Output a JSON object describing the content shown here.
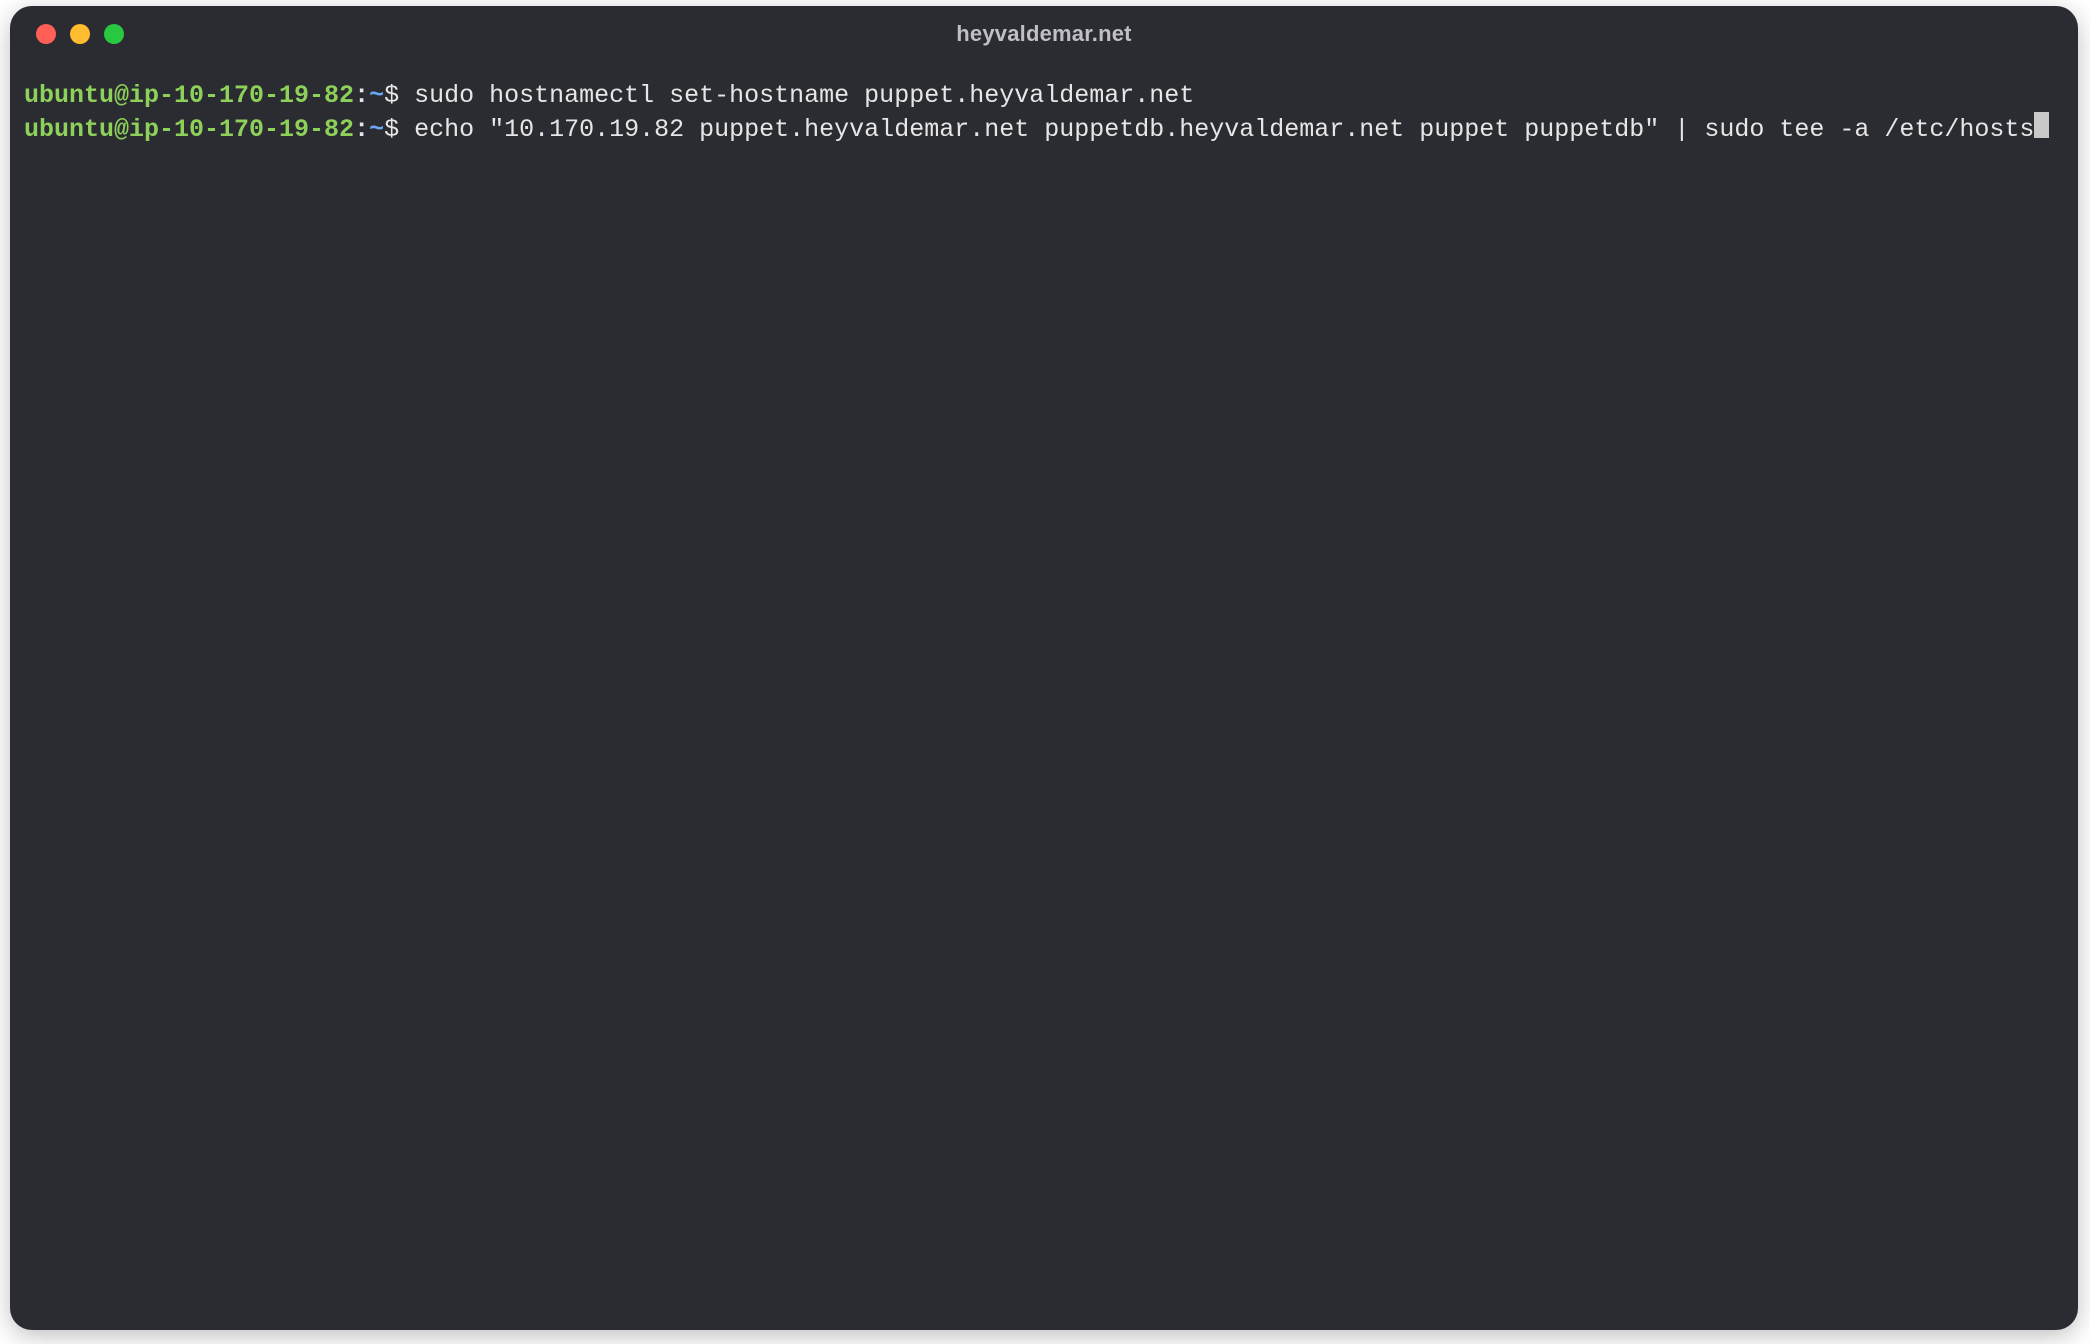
{
  "window": {
    "title": "heyvaldemar.net"
  },
  "traffic_lights": {
    "close_color": "#ff5f57",
    "minimize_color": "#febc2e",
    "zoom_color": "#28c840"
  },
  "terminal": {
    "lines": [
      {
        "user": "ubuntu@ip-10-170-19-82",
        "sep": ":",
        "path": "~",
        "dollar": "$ ",
        "command": "sudo hostnamectl set-hostname puppet.heyvaldemar.net"
      },
      {
        "user": "ubuntu@ip-10-170-19-82",
        "sep": ":",
        "path": "~",
        "dollar": "$ ",
        "command": "echo \"10.170.19.82 puppet.heyvaldemar.net puppetdb.heyvaldemar.net puppet puppetdb\" | sudo tee -a /etc/hosts"
      }
    ]
  }
}
